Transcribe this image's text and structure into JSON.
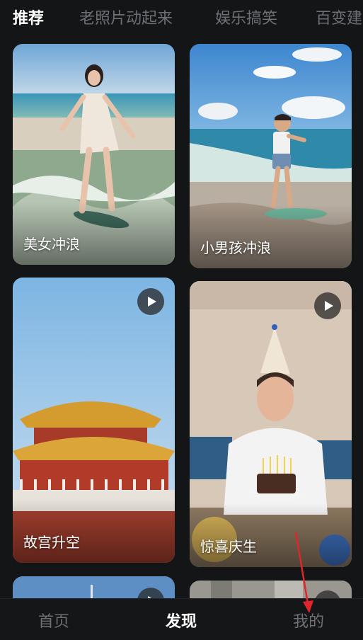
{
  "top_tabs": [
    {
      "label": "推荐",
      "active": true
    },
    {
      "label": "老照片动起来",
      "active": false
    },
    {
      "label": "娱乐搞笑",
      "active": false
    },
    {
      "label": "百变建",
      "active": false
    }
  ],
  "feed": {
    "cards": [
      {
        "title": "美女冲浪",
        "has_play_icon": false
      },
      {
        "title": "小男孩冲浪",
        "has_play_icon": false
      },
      {
        "title": "故宫升空",
        "has_play_icon": true
      },
      {
        "title": "惊喜庆生",
        "has_play_icon": true
      },
      {
        "title": "",
        "has_play_icon": true
      },
      {
        "title": "",
        "has_play_icon": true
      }
    ]
  },
  "bottom_nav": [
    {
      "label": "首页",
      "active": false
    },
    {
      "label": "发现",
      "active": true
    },
    {
      "label": "我的",
      "active": false
    }
  ],
  "annotation": {
    "color": "#e0262a",
    "icon": "red-arrow-pointing-to-mine-tab"
  },
  "colors": {
    "background": "#141517",
    "inactive_text": "#6d6f74",
    "active_text": "#ffffff"
  }
}
